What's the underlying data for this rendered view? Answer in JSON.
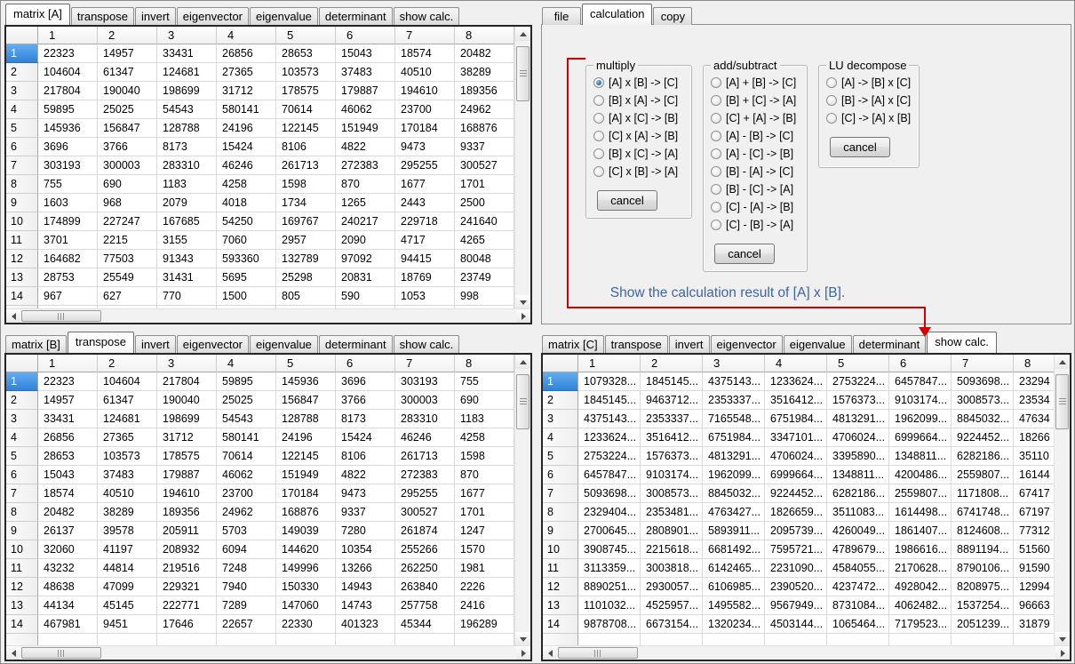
{
  "colors": {
    "annotation_line": "#d40000",
    "annotation_text": "#3c64a8",
    "selected_row_header": "#2f83d8",
    "radio_selected_dot": "#2a72b8"
  },
  "matrix_a": {
    "tabs": [
      "matrix [A]",
      "transpose",
      "invert",
      "eigenvector",
      "eigenvalue",
      "determinant",
      "show calc."
    ],
    "active_tab": "matrix [A]",
    "columns": [
      "1",
      "2",
      "3",
      "4",
      "5",
      "6",
      "7",
      "8"
    ],
    "selected_row": "1",
    "rows": [
      [
        "22323",
        "14957",
        "33431",
        "26856",
        "28653",
        "15043",
        "18574",
        "20482"
      ],
      [
        "104604",
        "61347",
        "124681",
        "27365",
        "103573",
        "37483",
        "40510",
        "38289"
      ],
      [
        "217804",
        "190040",
        "198699",
        "31712",
        "178575",
        "179887",
        "194610",
        "189356"
      ],
      [
        "59895",
        "25025",
        "54543",
        "580141",
        "70614",
        "46062",
        "23700",
        "24962"
      ],
      [
        "145936",
        "156847",
        "128788",
        "24196",
        "122145",
        "151949",
        "170184",
        "168876"
      ],
      [
        "3696",
        "3766",
        "8173",
        "15424",
        "8106",
        "4822",
        "9473",
        "9337"
      ],
      [
        "303193",
        "300003",
        "283310",
        "46246",
        "261713",
        "272383",
        "295255",
        "300527"
      ],
      [
        "755",
        "690",
        "1183",
        "4258",
        "1598",
        "870",
        "1677",
        "1701"
      ],
      [
        "1603",
        "968",
        "2079",
        "4018",
        "1734",
        "1265",
        "2443",
        "2500"
      ],
      [
        "174899",
        "227247",
        "167685",
        "54250",
        "169767",
        "240217",
        "229718",
        "241640"
      ],
      [
        "3701",
        "2215",
        "3155",
        "7060",
        "2957",
        "2090",
        "4717",
        "4265"
      ],
      [
        "164682",
        "77503",
        "91343",
        "593360",
        "132789",
        "97092",
        "94415",
        "80048"
      ],
      [
        "28753",
        "25549",
        "31431",
        "5695",
        "25298",
        "20831",
        "18769",
        "23749"
      ],
      [
        "967",
        "627",
        "770",
        "1500",
        "805",
        "590",
        "1053",
        "998"
      ]
    ]
  },
  "matrix_b": {
    "tabs": [
      "matrix [B]",
      "transpose",
      "invert",
      "eigenvector",
      "eigenvalue",
      "determinant",
      "show calc."
    ],
    "active_tab": "transpose",
    "columns": [
      "1",
      "2",
      "3",
      "4",
      "5",
      "6",
      "7",
      "8"
    ],
    "selected_row": "1",
    "rows": [
      [
        "22323",
        "104604",
        "217804",
        "59895",
        "145936",
        "3696",
        "303193",
        "755"
      ],
      [
        "14957",
        "61347",
        "190040",
        "25025",
        "156847",
        "3766",
        "300003",
        "690"
      ],
      [
        "33431",
        "124681",
        "198699",
        "54543",
        "128788",
        "8173",
        "283310",
        "1183"
      ],
      [
        "26856",
        "27365",
        "31712",
        "580141",
        "24196",
        "15424",
        "46246",
        "4258"
      ],
      [
        "28653",
        "103573",
        "178575",
        "70614",
        "122145",
        "8106",
        "261713",
        "1598"
      ],
      [
        "15043",
        "37483",
        "179887",
        "46062",
        "151949",
        "4822",
        "272383",
        "870"
      ],
      [
        "18574",
        "40510",
        "194610",
        "23700",
        "170184",
        "9473",
        "295255",
        "1677"
      ],
      [
        "20482",
        "38289",
        "189356",
        "24962",
        "168876",
        "9337",
        "300527",
        "1701"
      ],
      [
        "26137",
        "39578",
        "205911",
        "5703",
        "149039",
        "7280",
        "261874",
        "1247"
      ],
      [
        "32060",
        "41197",
        "208932",
        "6094",
        "144620",
        "10354",
        "255266",
        "1570"
      ],
      [
        "43232",
        "44814",
        "219516",
        "7248",
        "149996",
        "13266",
        "262250",
        "1981"
      ],
      [
        "48638",
        "47099",
        "229321",
        "7940",
        "150330",
        "14943",
        "263840",
        "2226"
      ],
      [
        "44134",
        "45145",
        "222771",
        "7289",
        "147060",
        "14743",
        "257758",
        "2416"
      ],
      [
        "467981",
        "9451",
        "17646",
        "22657",
        "22330",
        "401323",
        "45344",
        "196289"
      ]
    ]
  },
  "matrix_c": {
    "tabs": [
      "matrix [C]",
      "transpose",
      "invert",
      "eigenvector",
      "eigenvalue",
      "determinant",
      "show calc."
    ],
    "active_tab": "show calc.",
    "columns": [
      "1",
      "2",
      "3",
      "4",
      "5",
      "6",
      "7",
      "8"
    ],
    "selected_row": "1",
    "rows": [
      [
        "1079328...",
        "1845145...",
        "4375143...",
        "1233624...",
        "2753224...",
        "6457847...",
        "5093698...",
        "23294"
      ],
      [
        "1845145...",
        "9463712...",
        "2353337...",
        "3516412...",
        "1576373...",
        "9103174...",
        "3008573...",
        "23534"
      ],
      [
        "4375143...",
        "2353337...",
        "7165548...",
        "6751984...",
        "4813291...",
        "1962099...",
        "8845032...",
        "47634"
      ],
      [
        "1233624...",
        "3516412...",
        "6751984...",
        "3347101...",
        "4706024...",
        "6999664...",
        "9224452...",
        "18266"
      ],
      [
        "2753224...",
        "1576373...",
        "4813291...",
        "4706024...",
        "3395890...",
        "1348811...",
        "6282186...",
        "35110"
      ],
      [
        "6457847...",
        "9103174...",
        "1962099...",
        "6999664...",
        "1348811...",
        "4200486...",
        "2559807...",
        "16144"
      ],
      [
        "5093698...",
        "3008573...",
        "8845032...",
        "9224452...",
        "6282186...",
        "2559807...",
        "1171808...",
        "67417"
      ],
      [
        "2329404...",
        "2353481...",
        "4763427...",
        "1826659...",
        "3511083...",
        "1614498...",
        "6741748...",
        "67197"
      ],
      [
        "2700645...",
        "2808901...",
        "5893911...",
        "2095739...",
        "4260049...",
        "1861407...",
        "8124608...",
        "77312"
      ],
      [
        "3908745...",
        "2215618...",
        "6681492...",
        "7595721...",
        "4789679...",
        "1986616...",
        "8891194...",
        "51560"
      ],
      [
        "3113359...",
        "3003818...",
        "6142465...",
        "2231090...",
        "4584055...",
        "2170628...",
        "8790106...",
        "91590"
      ],
      [
        "8890251...",
        "2930057...",
        "6106985...",
        "2390520...",
        "4237472...",
        "4928042...",
        "8208975...",
        "12994"
      ],
      [
        "1101032...",
        "4525957...",
        "1495582...",
        "9567949...",
        "8731084...",
        "4062482...",
        "1537254...",
        "96663"
      ],
      [
        "9878708...",
        "6673154...",
        "1320234...",
        "4503144...",
        "1065464...",
        "7179523...",
        "2051239...",
        "31879"
      ]
    ]
  },
  "calculation": {
    "tabs": [
      "file",
      "calculation",
      "copy"
    ],
    "active_tab": "calculation",
    "groups": [
      {
        "title": "multiply",
        "options": [
          "[A] x [B] -> [C]",
          "[B] x [A] -> [C]",
          "[A] x [C] -> [B]",
          "[C] x [A] -> [B]",
          "[B] x [C] -> [A]",
          "[C] x [B] -> [A]"
        ],
        "selected": "[A] x [B] -> [C]",
        "cancel_label": "cancel"
      },
      {
        "title": "add/subtract",
        "options": [
          "[A] + [B] -> [C]",
          "[B] + [C] -> [A]",
          "[C] + [A] -> [B]",
          "[A] - [B] -> [C]",
          "[A] - [C] -> [B]",
          "[B] - [A] -> [C]",
          "[B] - [C] -> [A]",
          "[C] - [A] -> [B]",
          "[C] - [B] -> [A]"
        ],
        "selected": null,
        "cancel_label": "cancel"
      },
      {
        "title": "LU decompose",
        "options": [
          "[A] -> [B] x [C]",
          "[B] -> [A] x [C]",
          "[C] -> [A] x [B]"
        ],
        "selected": null,
        "cancel_label": "cancel"
      }
    ],
    "annotation": {
      "text": "Show the calculation result of [A] x [B]."
    }
  }
}
